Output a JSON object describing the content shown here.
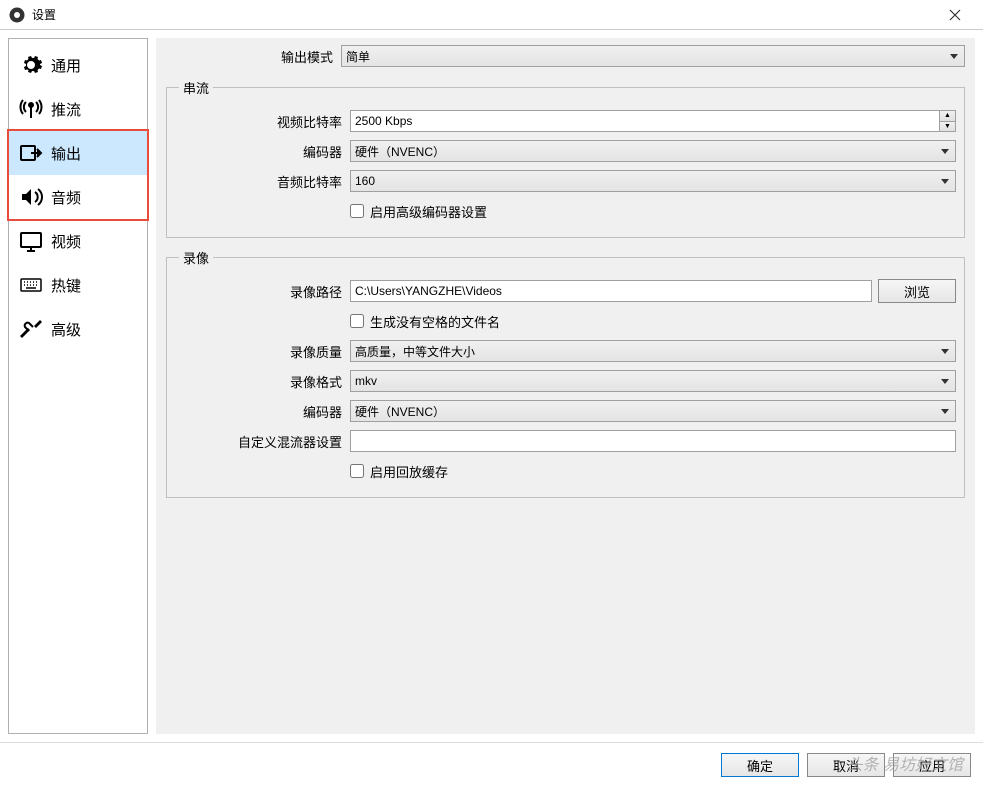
{
  "window": {
    "title": "设置"
  },
  "sidebar": {
    "items": [
      {
        "label": "通用"
      },
      {
        "label": "推流"
      },
      {
        "label": "输出"
      },
      {
        "label": "音频"
      },
      {
        "label": "视频"
      },
      {
        "label": "热键"
      },
      {
        "label": "高级"
      }
    ]
  },
  "main": {
    "output_mode_label": "输出模式",
    "output_mode_value": "简单",
    "streaming": {
      "legend": "串流",
      "video_bitrate_label": "视频比特率",
      "video_bitrate_value": "2500 Kbps",
      "encoder_label": "编码器",
      "encoder_value": "硬件（NVENC）",
      "audio_bitrate_label": "音频比特率",
      "audio_bitrate_value": "160",
      "advanced_encoder_label": "启用高级编码器设置"
    },
    "recording": {
      "legend": "录像",
      "path_label": "录像路径",
      "path_value": "C:\\Users\\YANGZHE\\Videos",
      "browse_btn": "浏览",
      "no_space_label": "生成没有空格的文件名",
      "quality_label": "录像质量",
      "quality_value": "高质量，中等文件大小",
      "format_label": "录像格式",
      "format_value": "mkv",
      "encoder_label": "编码器",
      "encoder_value": "硬件（NVENC）",
      "muxer_label": "自定义混流器设置",
      "muxer_value": "",
      "replay_buffer_label": "启用回放缓存"
    }
  },
  "footer": {
    "ok": "确定",
    "cancel": "取消",
    "apply": "应用"
  },
  "watermark": "头条 易坊好文馆"
}
